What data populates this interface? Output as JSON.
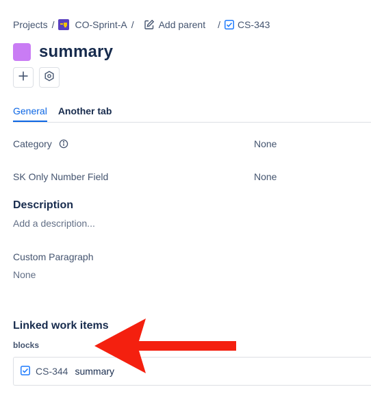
{
  "breadcrumb": {
    "projects": "Projects",
    "separator": "/",
    "project_name": "CO-Sprint-A",
    "add_parent": "Add parent",
    "issue_key": "CS-343"
  },
  "issue": {
    "title": "summary",
    "type_color": "#c97cf4"
  },
  "actions": {
    "add_icon": "plus-icon",
    "apps_icon": "hexagon-gear-icon"
  },
  "tabs": [
    {
      "label": "General",
      "active": true
    },
    {
      "label": "Another tab",
      "active": false
    }
  ],
  "fields": {
    "category": {
      "label": "Category",
      "value": "None"
    },
    "sk_number": {
      "label": "SK Only Number Field",
      "value": "None"
    }
  },
  "description": {
    "heading": "Description",
    "placeholder": "Add a description..."
  },
  "custom_paragraph": {
    "label": "Custom Paragraph",
    "value": "None"
  },
  "linked": {
    "heading": "Linked work items",
    "link_type": "blocks",
    "items": [
      {
        "key": "CS-344",
        "summary": "summary"
      }
    ]
  },
  "colors": {
    "accent": "#0c66e4",
    "annotation_arrow": "#f4200f"
  }
}
